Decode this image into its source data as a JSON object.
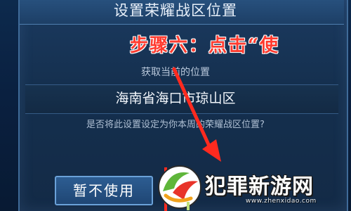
{
  "dialog": {
    "title": "设置荣耀战区位置",
    "subtitle": "获取当前的位置",
    "location": "海南省海口市琼山区",
    "question": "是否将此设置设定为你本周的荣耀战区位置?",
    "cancel_label": "暂不使用"
  },
  "annotation": {
    "step_text": "步骤六：点击“使"
  },
  "watermark": {
    "text": "犯罪新游网",
    "url": "www.zhenxidao.com"
  },
  "colors": {
    "annotation": "#ff3b2f",
    "dialog_bg": "#15304f",
    "button_border": "#6aa1d8"
  }
}
